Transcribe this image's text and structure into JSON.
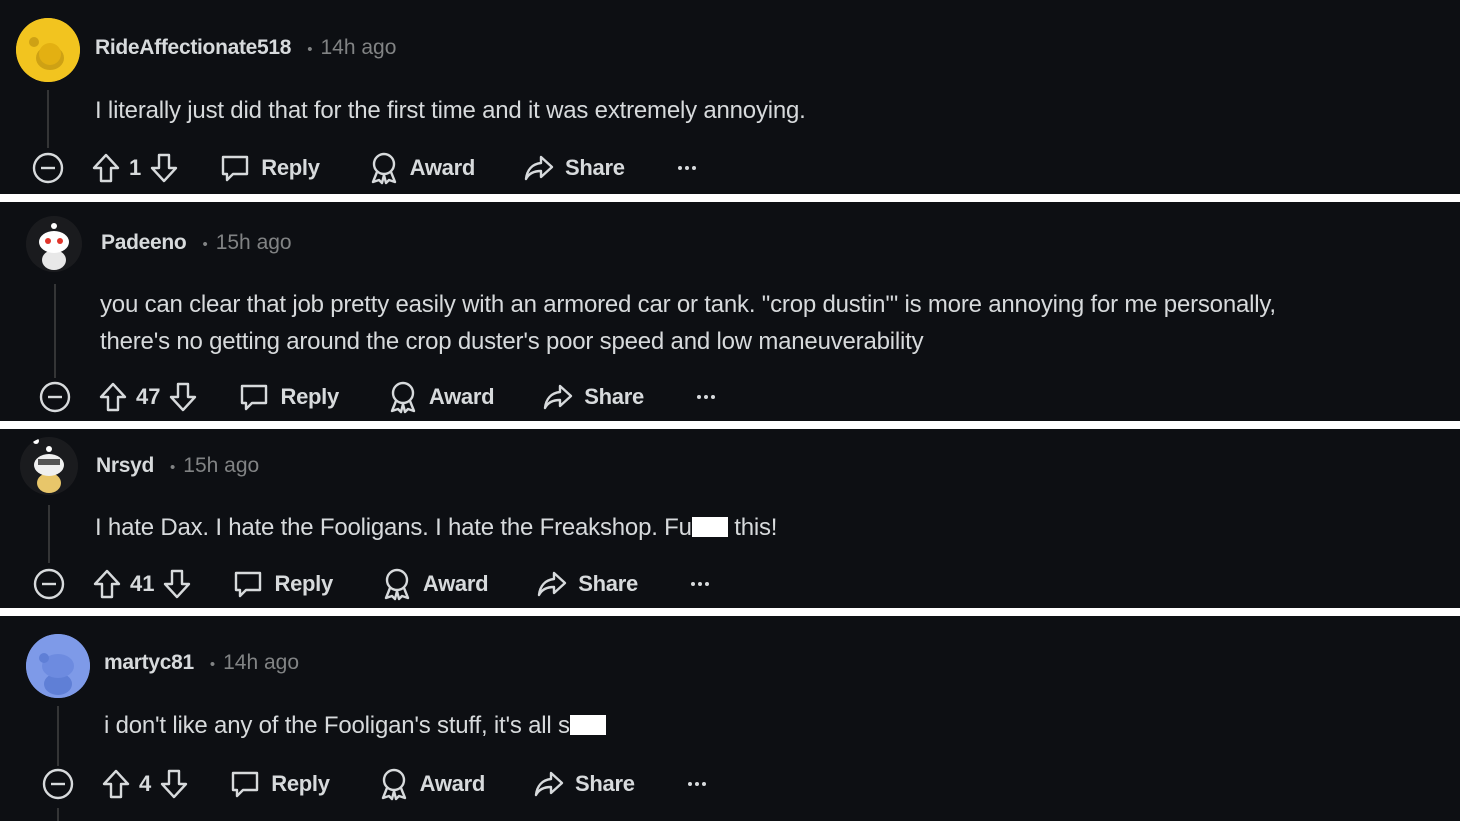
{
  "comments": [
    {
      "username": "RideAffectionate518",
      "dot": "•",
      "time": "14h ago",
      "text": "I literally just did that for the first time and it was extremely annoying.",
      "score": "1",
      "avatar_color": "#f2c41f"
    },
    {
      "username": "Padeeno",
      "dot": "•",
      "time": "15h ago",
      "text_line1": "you can clear that job pretty easily with an armored car or tank. \"crop dustin'\" is more annoying for me personally,",
      "text_line2": "there's no getting around the crop duster's poor speed and low maneuverability",
      "score": "47",
      "avatar_color": "#ffffff"
    },
    {
      "username": "Nrsyd",
      "dot": "•",
      "time": "15h ago",
      "text_before": "I hate Dax. I hate the Fooligans. I hate the Freakshop. Fu",
      "text_after": " this!",
      "score": "41",
      "avatar_color": "#ffffff"
    },
    {
      "username": "martyc81",
      "dot": "•",
      "time": "14h ago",
      "text_before": "i don't like any of the Fooligan's stuff, it's all s",
      "text_after": "",
      "score": "4",
      "avatar_color": "#7e9ae8"
    }
  ],
  "actions": {
    "reply_label": "Reply",
    "award_label": "Award",
    "share_label": "Share",
    "more_label": "···"
  },
  "icons": [
    "collapse-icon",
    "upvote-icon",
    "downvote-icon",
    "comment-icon",
    "award-icon",
    "share-icon",
    "more-icon"
  ],
  "colors": {
    "background": "#0d0f13",
    "text": "#d7dadc",
    "muted": "#818384",
    "separator": "#ffffff"
  }
}
